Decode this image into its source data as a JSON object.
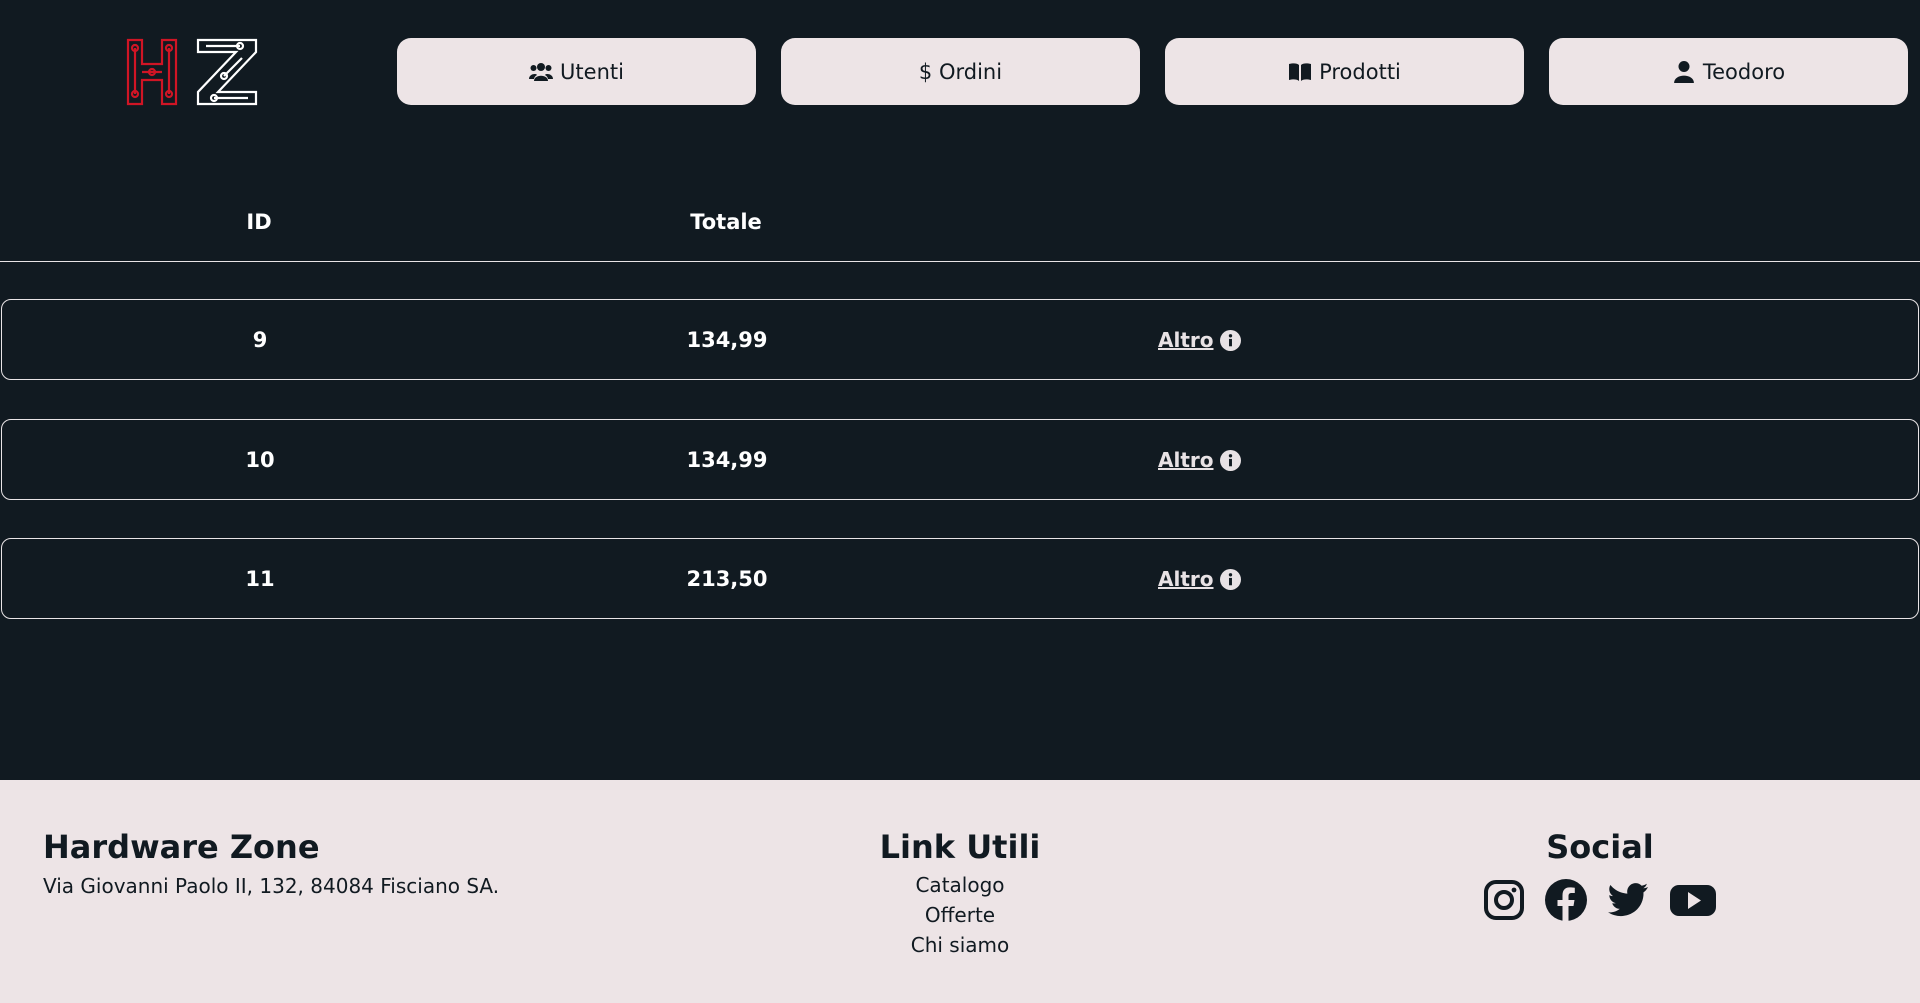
{
  "header": {
    "logo_text": "HZ",
    "nav": [
      {
        "label": "Utenti",
        "icon": "users-icon"
      },
      {
        "label": "$ Ordini",
        "icon": ""
      },
      {
        "label": "Prodotti",
        "icon": "book-open-icon"
      },
      {
        "label": "Teodoro",
        "icon": "user-icon"
      }
    ]
  },
  "table": {
    "headers": {
      "id": "ID",
      "totale": "Totale"
    },
    "rows": [
      {
        "id": "9",
        "totale": "134,99",
        "action": "Altro"
      },
      {
        "id": "10",
        "totale": "134,99",
        "action": "Altro"
      },
      {
        "id": "11",
        "totale": "213,50",
        "action": "Altro"
      }
    ]
  },
  "footer": {
    "brand": {
      "title": "Hardware Zone",
      "address": "Via Giovanni Paolo II, 132, 84084 Fisciano SA."
    },
    "links": {
      "title": "Link Utili",
      "items": [
        "Catalogo",
        "Offerte",
        "Chi siamo"
      ]
    },
    "social": {
      "title": "Social",
      "icons": [
        "instagram-icon",
        "facebook-icon",
        "twitter-icon",
        "youtube-icon"
      ]
    }
  },
  "colors": {
    "background": "#111a21",
    "light": "#ede4e6",
    "logo_red": "#d01525",
    "logo_white": "#ffffff"
  }
}
